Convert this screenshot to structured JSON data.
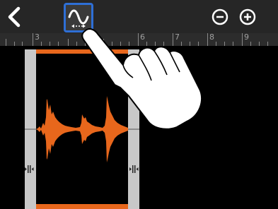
{
  "toolbar": {
    "back_icon": "chevron-left-icon",
    "waveform_icon": "sine-wave-icon",
    "zoom_out_icon": "zoom-out-icon",
    "zoom_in_icon": "zoom-in-icon",
    "highlight_color": "#2e6fd6"
  },
  "ruler": {
    "labels": [
      "3",
      "6",
      "7",
      "8",
      "9"
    ]
  },
  "region": {
    "accent_color": "#e8671c",
    "handle_icon": "trim-handle-icon"
  }
}
